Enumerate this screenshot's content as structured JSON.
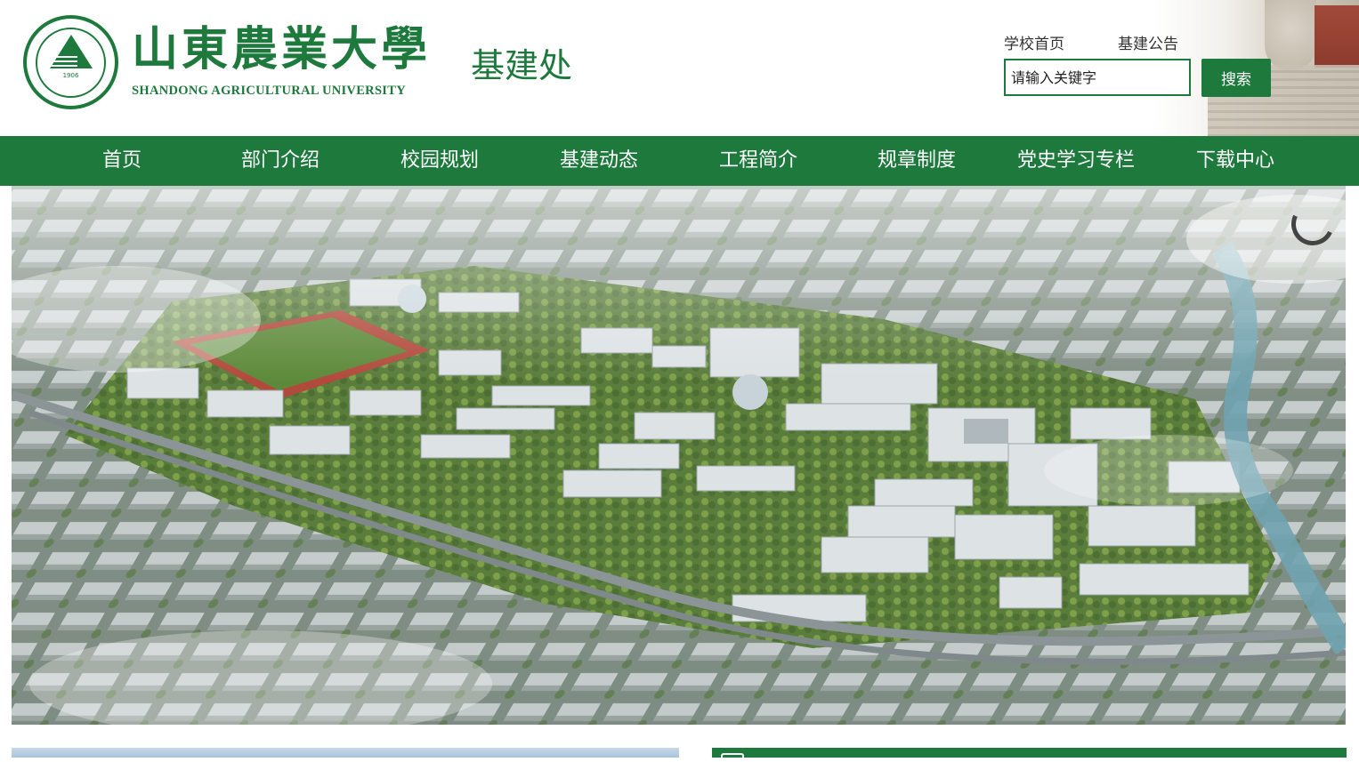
{
  "header": {
    "university_name_cn": "山東農業大學",
    "university_name_en": "SHANDONG AGRICULTURAL UNIVERSITY",
    "department": "基建处",
    "logo_year": "1906",
    "links": [
      {
        "label": "学校首页"
      },
      {
        "label": "基建公告"
      }
    ],
    "search": {
      "placeholder": "请输入关键字",
      "button_label": "搜索"
    }
  },
  "nav": {
    "items": [
      {
        "label": "首页"
      },
      {
        "label": "部门介绍"
      },
      {
        "label": "校园规划"
      },
      {
        "label": "基建动态"
      },
      {
        "label": "工程简介"
      },
      {
        "label": "规章制度"
      },
      {
        "label": "党史学习专栏"
      },
      {
        "label": "下载中心"
      }
    ]
  },
  "colors": {
    "brand_green": "#1e7a3c",
    "nav_text": "#ffffff"
  },
  "hero": {
    "image": "campus-aerial-rendering",
    "loading_indicator": "spinner-icon"
  }
}
